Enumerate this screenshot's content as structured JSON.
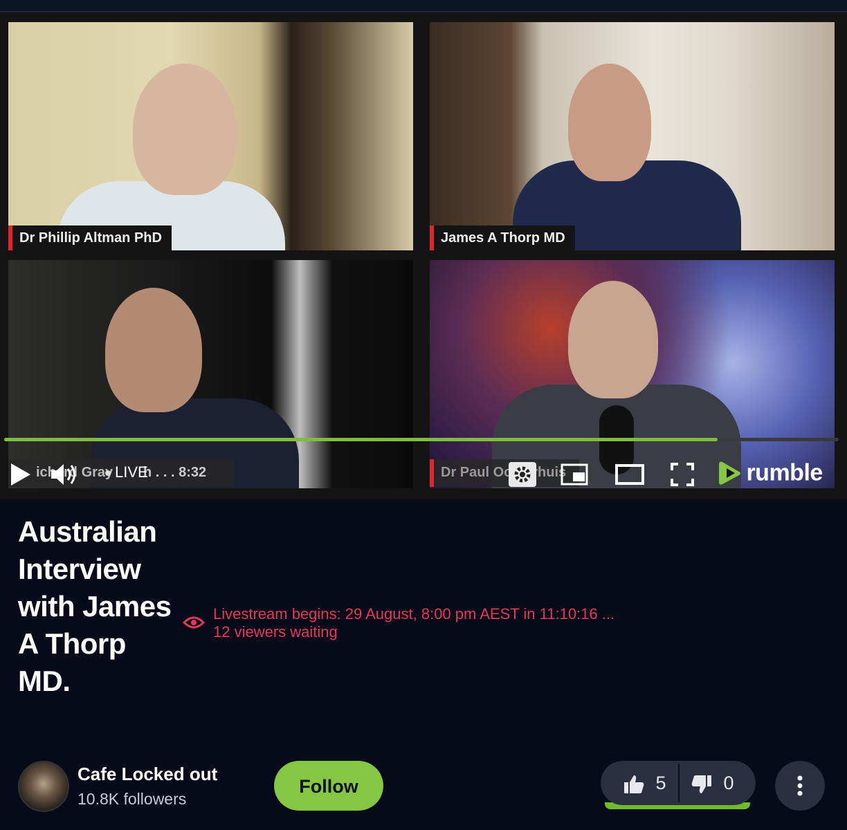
{
  "player": {
    "tiles": [
      {
        "name": "Dr Phillip Altman PhD"
      },
      {
        "name": "James A Thorp MD"
      },
      {
        "name": "Richard Gray Cardiotech"
      },
      {
        "name": "Dr Paul Oosterhuis"
      }
    ],
    "overlay_left_text": "ichard Gray",
    "overlay_right_text": "Dr Paul Oosterhuis",
    "live_label": "LIVE",
    "time_text": "h . . . 8:32",
    "progress_fraction": 0.855,
    "brand": "rumble",
    "colors": {
      "progress": "#7ebd3f",
      "brand": "#85c742"
    }
  },
  "video": {
    "title": "Australian Interview with James A Thorp MD.",
    "livestream_line": "Livestream begins: 29 August, 8:00 pm AEST in 11:10:16 ...",
    "viewers_line": "12 viewers waiting"
  },
  "channel": {
    "name": "Cafe Locked out",
    "followers": "10.8K followers"
  },
  "actions": {
    "follow_label": "Follow",
    "likes": "5",
    "dislikes": "0"
  },
  "icons": [
    "play-icon",
    "volume-icon",
    "settings-icon",
    "pip-icon",
    "theater-icon",
    "fullscreen-icon",
    "rumble-logo-icon",
    "eye-icon",
    "thumbs-up-icon",
    "thumbs-down-icon",
    "more-icon"
  ]
}
